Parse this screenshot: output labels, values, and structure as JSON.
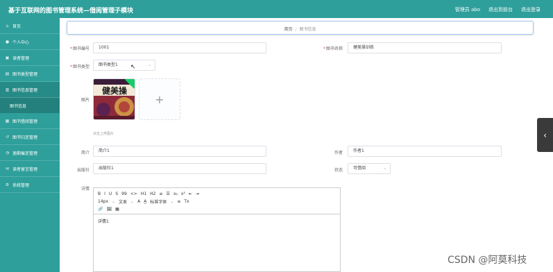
{
  "header": {
    "title": "基于互联网的图书管理系统—借阅管理子模块",
    "admin_label": "管理员 abo",
    "exit_label": "退出到前台",
    "logout_label": "退出登录"
  },
  "sidebar": {
    "items": [
      {
        "label": "首页",
        "icon": "home-icon"
      },
      {
        "label": "个人中心",
        "icon": "user-icon"
      },
      {
        "label": "读者管理",
        "icon": "reader-icon"
      },
      {
        "label": "图书类型管理",
        "icon": "category-icon"
      },
      {
        "label": "图书信息管理",
        "icon": "book-icon",
        "sub": "图书信息"
      },
      {
        "label": "图书借阅管理",
        "icon": "borrow-icon"
      },
      {
        "label": "图书归还管理",
        "icon": "return-icon"
      },
      {
        "label": "逾期催还管理",
        "icon": "overdue-icon"
      },
      {
        "label": "读者留言管理",
        "icon": "message-icon"
      },
      {
        "label": "系统管理",
        "icon": "settings-icon"
      }
    ]
  },
  "breadcrumb": {
    "home": "首页",
    "separator": "/",
    "current": "图书信息"
  },
  "form": {
    "book_no_label": "图书编号",
    "book_no_value": "1001",
    "book_name_label": "图书名称",
    "book_name_value": "健美操训练",
    "book_type_label": "图书类型",
    "book_type_value": "图书类型1",
    "cover_label": "图片",
    "cover_text": "健美操",
    "upload_hint": "点击上传图片",
    "intro_label": "简介",
    "intro_value": "简介1",
    "author_label": "作者",
    "author_value": "作者1",
    "publisher_label": "出版社",
    "publisher_value": "出版社1",
    "status_label": "状态",
    "status_value": "可借阅",
    "detail_label": "详情",
    "detail_value": "详情1"
  },
  "editor": {
    "row1": [
      "B",
      "I",
      "U",
      "S",
      "99",
      "<>",
      "H1",
      "H2",
      "≡",
      "☰",
      "x₂",
      "x²",
      "⇤",
      "⇥"
    ],
    "row2": [
      "14px",
      "文本",
      "A",
      "A̲",
      "标准字体",
      "≡",
      "Tx"
    ],
    "row3": [
      "🔗",
      "🖼",
      "▦"
    ]
  },
  "watermark": "CSDN @阿莫科技",
  "colors": {
    "sidebar": "#2e9f9b",
    "topbar": "#2e9f9b",
    "required": "#e54545"
  }
}
